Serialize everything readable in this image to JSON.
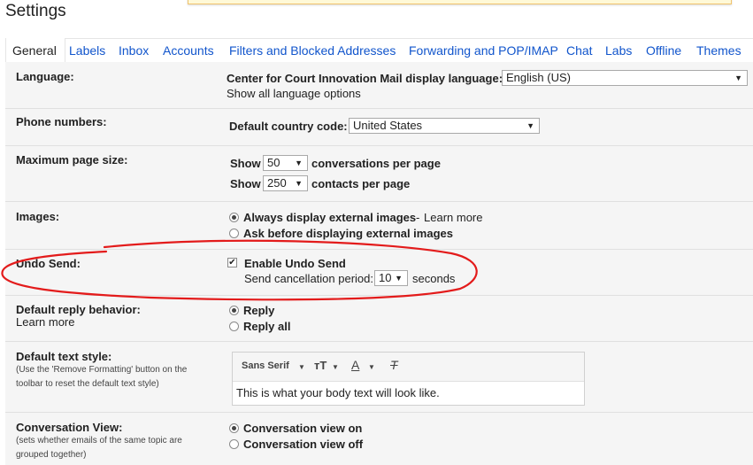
{
  "page": {
    "title": "Settings"
  },
  "tabs": [
    {
      "label": "General"
    },
    {
      "label": "Labels"
    },
    {
      "label": "Inbox"
    },
    {
      "label": "Accounts"
    },
    {
      "label": "Filters and Blocked Addresses"
    },
    {
      "label": "Forwarding and POP/IMAP"
    },
    {
      "label": "Chat"
    },
    {
      "label": "Labs"
    },
    {
      "label": "Offline"
    },
    {
      "label": "Themes"
    }
  ],
  "language": {
    "label": "Language:",
    "prompt": "Center for Court Innovation Mail display language:",
    "value": "English (US)",
    "show_all": "Show all language options"
  },
  "phone": {
    "label": "Phone numbers:",
    "prompt": "Default country code:",
    "value": "United States"
  },
  "page_size": {
    "label": "Maximum page size:",
    "show": "Show",
    "conversations_value": "50",
    "conversations_suffix": "conversations per page",
    "contacts_value": "250",
    "contacts_suffix": "contacts per page"
  },
  "images": {
    "label": "Images:",
    "option1": "Always display external images",
    "option1_sep": "-",
    "learn_more": "Learn more",
    "option2": "Ask before displaying external images",
    "selected": "option1"
  },
  "undo_send": {
    "label": "Undo Send:",
    "enable": "Enable Undo Send",
    "enabled": true,
    "period_prompt": "Send cancellation period:",
    "period_value": "10",
    "period_suffix": "seconds",
    "annotation_color": "#e31b1b"
  },
  "reply": {
    "label": "Default reply behavior:",
    "learn_more": "Learn more",
    "option1": "Reply",
    "option2": "Reply all",
    "selected": "option1"
  },
  "text_style": {
    "label": "Default text style:",
    "note": "(Use the 'Remove Formatting' button on the toolbar to reset the default text style)",
    "font": "Sans Serif",
    "size_icon": "text-size-icon",
    "color_icon": "text-color-icon",
    "clear_icon": "remove-formatting-icon",
    "preview": "This is what your body text will look like."
  },
  "conversation": {
    "label": "Conversation View:",
    "note": "(sets whether emails of the same topic are grouped together)",
    "option1": "Conversation view on",
    "option2": "Conversation view off",
    "selected": "option1"
  },
  "colors": {
    "link": "#1155cc",
    "background": "#f5f5f5",
    "annotation": "#e31b1b"
  }
}
